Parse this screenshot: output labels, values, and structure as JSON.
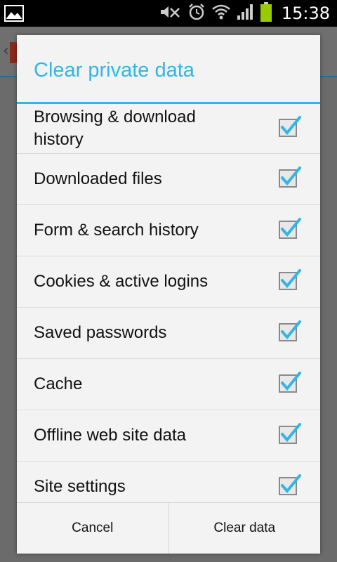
{
  "status_bar": {
    "time": "15:38",
    "icons": [
      "gallery-icon",
      "mute-icon",
      "alarm-icon",
      "wifi-icon",
      "signal-icon",
      "battery-icon"
    ],
    "battery_color": "#99cc00"
  },
  "dialog": {
    "title": "Clear private data",
    "accent_color": "#33b5e5",
    "items": [
      {
        "label": "Browsing & download history",
        "checked": true
      },
      {
        "label": "Downloaded files",
        "checked": true
      },
      {
        "label": "Form & search history",
        "checked": true
      },
      {
        "label": "Cookies & active logins",
        "checked": true
      },
      {
        "label": "Saved passwords",
        "checked": true
      },
      {
        "label": "Cache",
        "checked": true
      },
      {
        "label": "Offline web site data",
        "checked": true
      },
      {
        "label": "Site settings",
        "checked": true
      }
    ],
    "cancel_label": "Cancel",
    "confirm_label": "Clear data"
  }
}
